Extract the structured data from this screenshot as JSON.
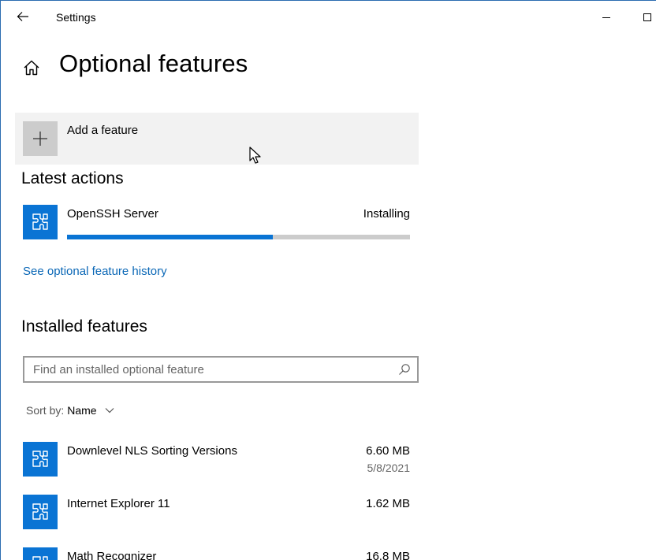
{
  "window": {
    "title": "Settings"
  },
  "header": {
    "page_title": "Optional features"
  },
  "add_feature": {
    "label": "Add a feature"
  },
  "latest_actions": {
    "heading": "Latest actions",
    "items": [
      {
        "name": "OpenSSH Server",
        "status": "Installing",
        "progress": 0.6
      }
    ]
  },
  "history_link": "See optional feature history",
  "installed": {
    "heading": "Installed features",
    "search_placeholder": "Find an installed optional feature",
    "sort_label": "Sort by:",
    "sort_value": "Name",
    "items": [
      {
        "name": "Downlevel NLS Sorting Versions",
        "size": "6.60 MB",
        "date": "5/8/2021"
      },
      {
        "name": "Internet Explorer 11",
        "size": "1.62 MB",
        "date": ""
      },
      {
        "name": "Math Recognizer",
        "size": "16.8 MB",
        "date": ""
      }
    ]
  },
  "colors": {
    "accent": "#0a74d4",
    "link": "#0a67b6",
    "add_button_bg": "#f2f2f2",
    "progress_track": "#cccccc"
  },
  "icons": {
    "back": "back-arrow-icon",
    "home": "home-icon",
    "plus": "plus-icon",
    "feature": "puzzle-icon",
    "search": "search-icon",
    "sort": "chevron-down-icon"
  }
}
